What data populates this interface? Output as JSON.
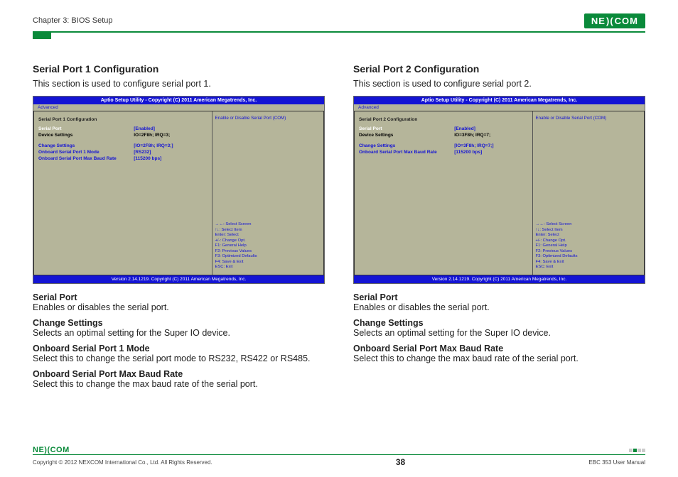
{
  "header": {
    "chapter": "Chapter 3: BIOS Setup",
    "logo": "NEXCOM"
  },
  "left": {
    "title": "Serial Port 1 Configuration",
    "desc": "This section is used to configure serial port 1.",
    "bios": {
      "title": "Aptio Setup Utility - Copyright (C) 2011 American Megatrends, Inc.",
      "tab": "Advanced",
      "heading": "Serial Port 1 Configuration",
      "rows": [
        {
          "label": "Serial Port",
          "value": "[Enabled]",
          "hilite": true
        },
        {
          "label": "Device Settings",
          "value": "IO=2F8h; IRQ=3;",
          "plain": true
        }
      ],
      "rows2": [
        {
          "label": "Change Settings",
          "value": "[IO=2F8h; IRQ=3;]"
        },
        {
          "label": "Onboard Serial Port 1 Mode",
          "value": "[RS232]"
        },
        {
          "label": "Onboard Serial Port Max Baud Rate",
          "value": "[115200 bps]"
        }
      ],
      "help_top": "Enable or Disable Serial Port (COM)",
      "help_bot": [
        "→←: Select Screen",
        "↑↓: Select Item",
        "Enter: Select",
        "+/-: Change Opt.",
        "F1: General Help",
        "F2: Previous Values",
        "F3: Optimized Defaults",
        "F4: Save & Exit",
        "ESC: Exit"
      ],
      "foot": "Version 2.14.1219. Copyright (C) 2011 American Megatrends, Inc."
    },
    "defs": [
      {
        "t": "Serial Port",
        "d": "Enables or disables the serial port."
      },
      {
        "t": "Change Settings",
        "d": "Selects an optimal setting for the Super IO device."
      },
      {
        "t": "Onboard Serial Port 1 Mode",
        "d": "Select this to change the serial port mode to RS232, RS422 or RS485."
      },
      {
        "t": "Onboard Serial Port Max Baud Rate",
        "d": "Select this to change the max baud rate of the serial port."
      }
    ]
  },
  "right": {
    "title": "Serial Port 2 Configuration",
    "desc": "This section is used to configure serial port 2.",
    "bios": {
      "title": "Aptio Setup Utility - Copyright (C) 2011 American Megatrends, Inc.",
      "tab": "Advanced",
      "heading": "Serial Port 2 Configuration",
      "rows": [
        {
          "label": "Serial Port",
          "value": "[Enabled]",
          "hilite": true
        },
        {
          "label": "Device Settings",
          "value": "IO=3F8h; IRQ=7;",
          "plain": true
        }
      ],
      "rows2": [
        {
          "label": "Change Settings",
          "value": "[IO=3F8h; IRQ=7;]"
        },
        {
          "label": "Onboard Serial Port Max Baud Rate",
          "value": "[115200 bps]"
        }
      ],
      "help_top": "Enable or Disable Serial Port (COM)",
      "help_bot": [
        "→←: Select Screen",
        "↑↓: Select Item",
        "Enter: Select",
        "+/-: Change Opt.",
        "F1: General Help",
        "F2: Previous Values",
        "F3: Optimized Defaults",
        "F4: Save & Exit",
        "ESC: Exit"
      ],
      "foot": "Version 2.14.1219. Copyright (C) 2011 American Megatrends, Inc."
    },
    "defs": [
      {
        "t": "Serial Port",
        "d": "Enables or disables the serial port."
      },
      {
        "t": "Change Settings",
        "d": "Selects an optimal setting for the Super IO device."
      },
      {
        "t": "Onboard Serial Port Max Baud Rate",
        "d": "Select this to change the max baud rate of the serial port."
      }
    ]
  },
  "footer": {
    "logo": "NE(COM",
    "copyright": "Copyright © 2012 NEXCOM International Co., Ltd. All Rights Reserved.",
    "page": "38",
    "manual": "EBC 353 User Manual"
  }
}
